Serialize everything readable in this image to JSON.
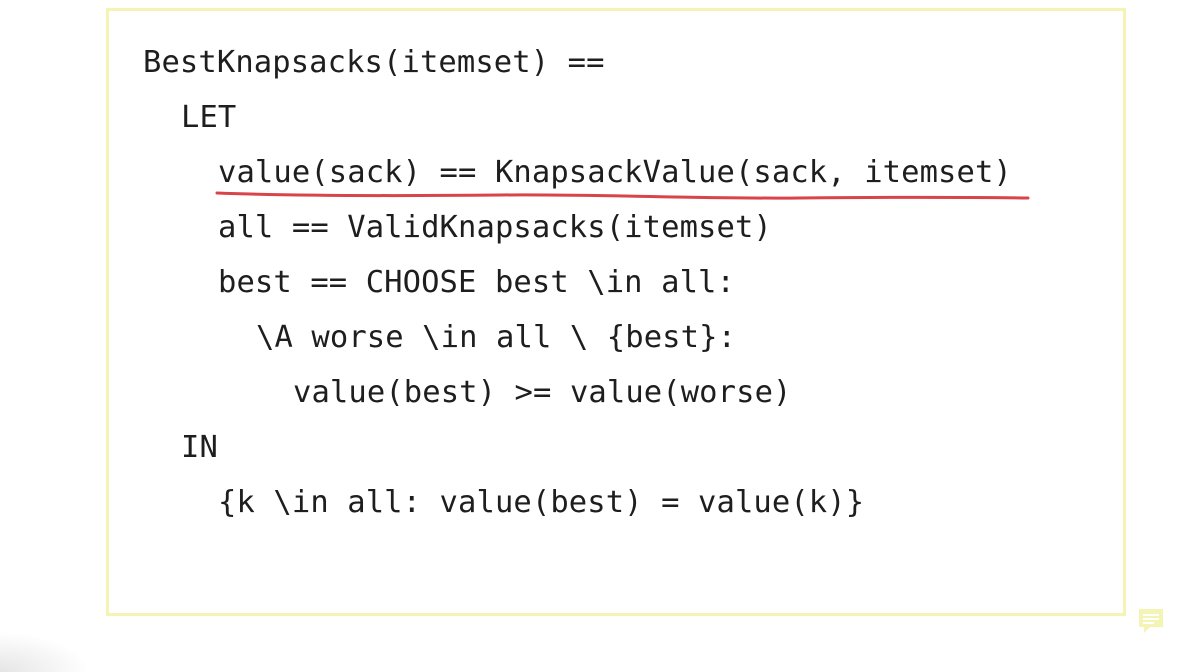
{
  "code": {
    "lines": [
      "BestKnapsacks(itemset) ==",
      "LET",
      "value(sack) == KnapsackValue(sack, itemset)",
      "all == ValidKnapsacks(itemset)",
      "best == CHOOSE best \\in all:",
      "\\A worse \\in all \\ {best}:",
      "value(best) >= value(worse)",
      "IN",
      "{k \\in all: value(best) = value(k)}"
    ]
  },
  "colors": {
    "box_border": "#f4f4b4",
    "text": "#1e1e1e",
    "underline": "#d9434a",
    "comment_icon": "#f4f4b4"
  },
  "annotation": {
    "underlined_line": 3
  },
  "icons": {
    "comment": "comment-icon"
  }
}
